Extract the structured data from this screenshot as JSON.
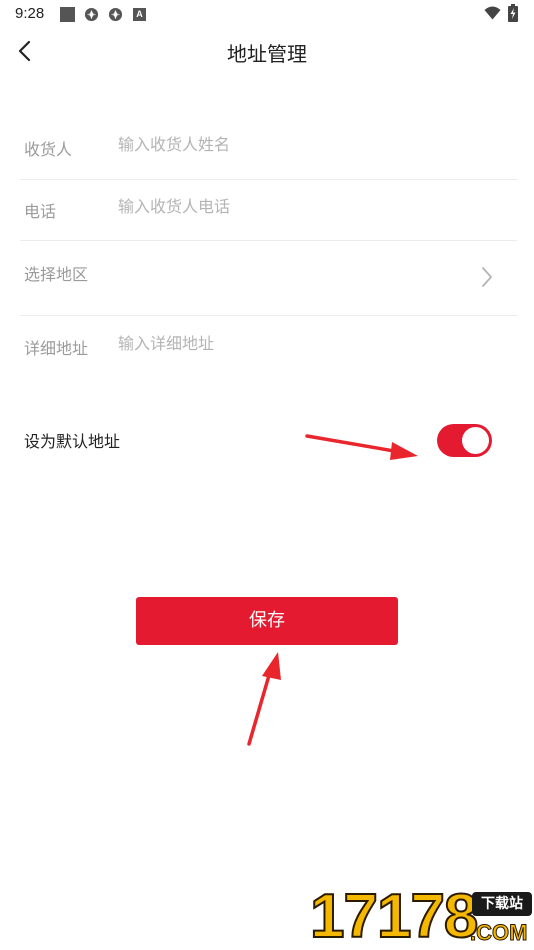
{
  "status_bar": {
    "time": "9:28",
    "icons": [
      "square-icon",
      "gear-icon",
      "gear-icon",
      "a-icon",
      "wifi-icon",
      "battery-icon"
    ],
    "a_icon_text": "A"
  },
  "header": {
    "title": "地址管理",
    "back_icon": "chevron-left-icon"
  },
  "form": {
    "recipient": {
      "label": "收货人",
      "placeholder": "输入收货人姓名",
      "value": ""
    },
    "phone": {
      "label": "电话",
      "placeholder": "输入收货人电话",
      "value": ""
    },
    "region": {
      "label": "选择地区",
      "icon": "chevron-right-icon"
    },
    "detail": {
      "label": "详细地址",
      "placeholder": "输入详细地址",
      "value": ""
    }
  },
  "default_address": {
    "label": "设为默认地址",
    "enabled": true
  },
  "save_button": {
    "label": "保存"
  },
  "colors": {
    "accent": "#e41b30",
    "label_gray": "#9b9b9b",
    "placeholder_gray": "#b4b4b4",
    "divider": "#ececec",
    "annotation_arrow": "#e8262c"
  },
  "watermark": {
    "digits": "17178",
    "badge": "下载站",
    "suffix": ".COM"
  }
}
